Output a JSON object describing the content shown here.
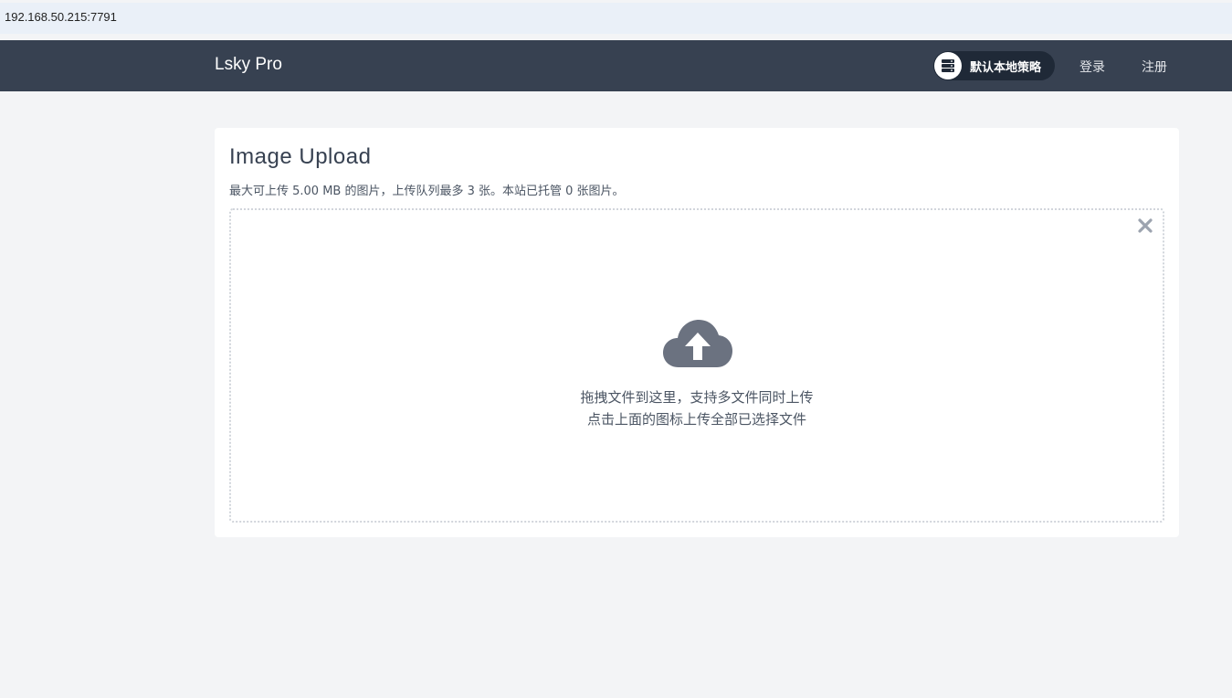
{
  "browser": {
    "url": "192.168.50.215:7791"
  },
  "navbar": {
    "brand": "Lsky Pro",
    "strategy_label": "默认本地策略",
    "login_label": "登录",
    "register_label": "注册",
    "background_color": "#374151"
  },
  "upload": {
    "title": "Image Upload",
    "subtitle": "最大可上传 5.00 MB 的图片，上传队列最多 3 张。本站已托管 0 张图片。",
    "hint_line1": "拖拽文件到这里，支持多文件同时上传",
    "hint_line2": "点击上面的图标上传全部已选择文件",
    "icons": {
      "upload": "cloud-upload-icon",
      "clear": "close-icon",
      "strategy": "server-icon"
    }
  }
}
